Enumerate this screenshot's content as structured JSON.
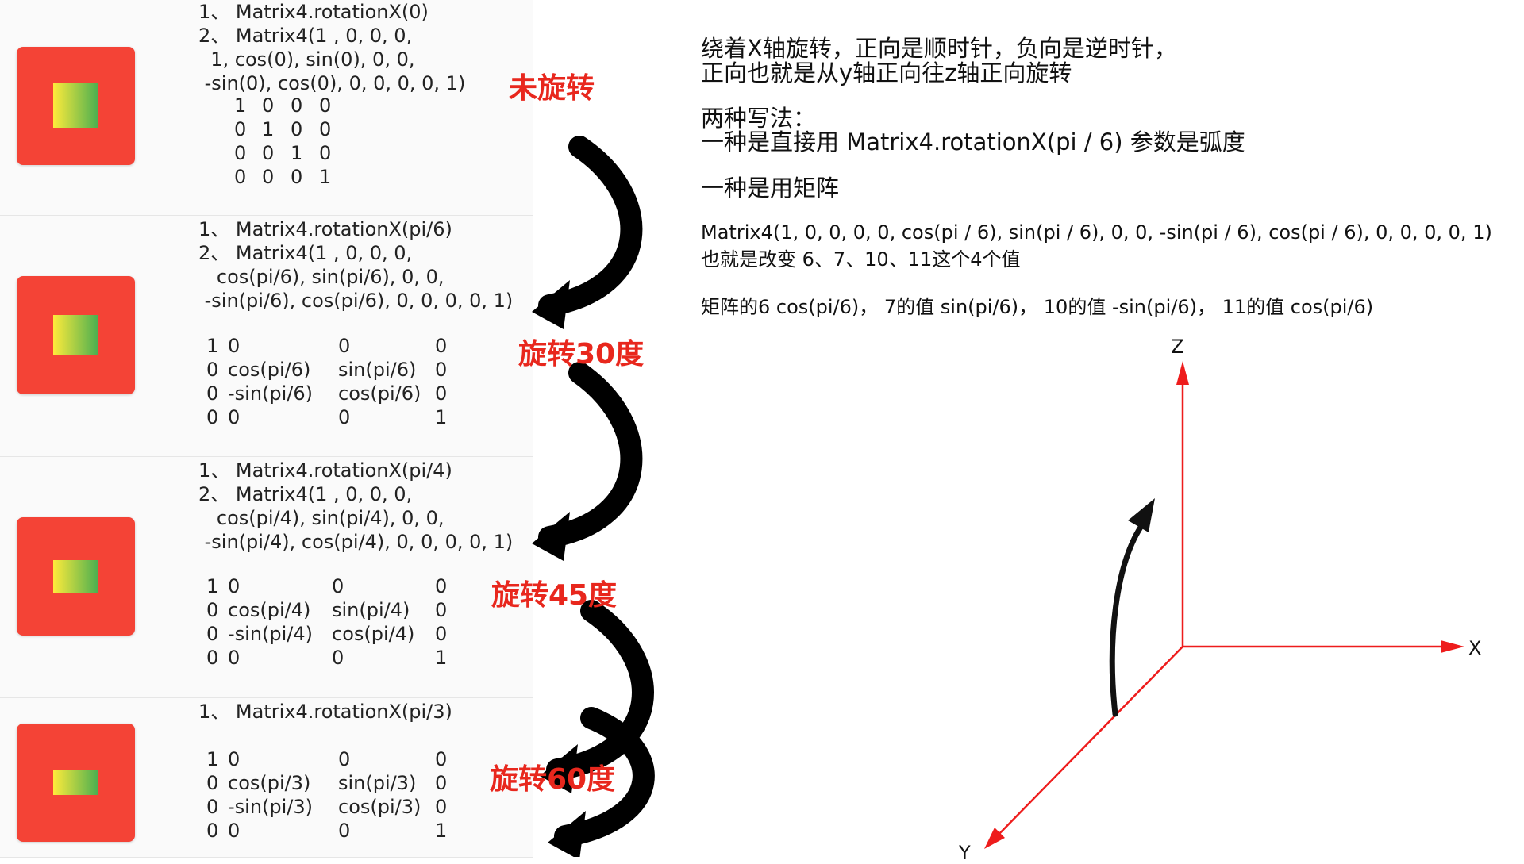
{
  "rows": [
    {
      "code": [
        "1、 Matrix4.rotationX(0)",
        "2、 Matrix4(1 , 0, 0, 0,",
        "  1, cos(0), sin(0), 0, 0,",
        " -sin(0), cos(0), 0, 0, 0, 0, 1)"
      ],
      "matrix": [
        [
          "1",
          "0",
          "0",
          "0"
        ],
        [
          "0",
          "1",
          "0",
          "0"
        ],
        [
          "0",
          "0",
          "1",
          "0"
        ],
        [
          "0",
          "0",
          "0",
          "1"
        ]
      ],
      "label": "未旋转"
    },
    {
      "code": [
        "1、 Matrix4.rotationX(pi/6)",
        "2、 Matrix4(1 , 0, 0, 0,",
        "   cos(pi/6), sin(pi/6), 0, 0,",
        " -sin(pi/6), cos(pi/6), 0, 0, 0, 0, 1)"
      ],
      "matrix": [
        [
          "1",
          "0",
          "0",
          "0"
        ],
        [
          "0",
          "cos(pi/6)",
          "sin(pi/6)",
          "0"
        ],
        [
          "0",
          "-sin(pi/6)",
          "cos(pi/6)",
          "0"
        ],
        [
          "0",
          "0",
          "0",
          "1"
        ]
      ],
      "label": "旋转30度"
    },
    {
      "code": [
        "1、 Matrix4.rotationX(pi/4)",
        "2、 Matrix4(1 , 0, 0, 0,",
        "   cos(pi/4), sin(pi/4), 0, 0,",
        " -sin(pi/4), cos(pi/4), 0, 0, 0, 0, 1)"
      ],
      "matrix": [
        [
          "1",
          "0",
          "0",
          "0"
        ],
        [
          "0",
          "cos(pi/4)",
          "sin(pi/4)",
          "0"
        ],
        [
          "0",
          "-sin(pi/4)",
          "cos(pi/4)",
          "0"
        ],
        [
          "0",
          "0",
          "0",
          "1"
        ]
      ],
      "label": "旋转45度"
    },
    {
      "code": [
        "1、 Matrix4.rotationX(pi/3)"
      ],
      "matrix": [
        [
          "1",
          "0",
          "0",
          "0"
        ],
        [
          "0",
          "cos(pi/3)",
          "sin(pi/3)",
          "0"
        ],
        [
          "0",
          "-sin(pi/3)",
          "cos(pi/3)",
          "0"
        ],
        [
          "0",
          "0",
          "0",
          "1"
        ]
      ],
      "label": "旋转60度"
    }
  ],
  "explanation": {
    "line1": "绕着X轴旋转，正向是顺时针，负向是逆时针，",
    "line2": "正向也就是从y轴正向往z轴正向旋转",
    "line3": "两种写法：",
    "line4": "一种是直接用  Matrix4.rotationX(pi / 6)  参数是弧度",
    "line5": "一种是用矩阵",
    "line6": "Matrix4(1, 0, 0, 0, 0, cos(pi / 6), sin(pi / 6), 0, 0, -sin(pi / 6), cos(pi / 6), 0, 0, 0, 0, 1)",
    "line7": "也就是改变 6、7、10、11这个4个值",
    "line8": "矩阵的6 cos(pi/6)，  7的值 sin(pi/6)，  10的值 -sin(pi/6)，  11的值 cos(pi/6)"
  },
  "axes": {
    "z": "Z",
    "x": "X",
    "y": "Y"
  },
  "colors": {
    "box": "#f44336",
    "grad_start": "#ffeb3b",
    "grad_end": "#4caf50",
    "label": "#e8271d",
    "axis": "#ee1c1c"
  }
}
